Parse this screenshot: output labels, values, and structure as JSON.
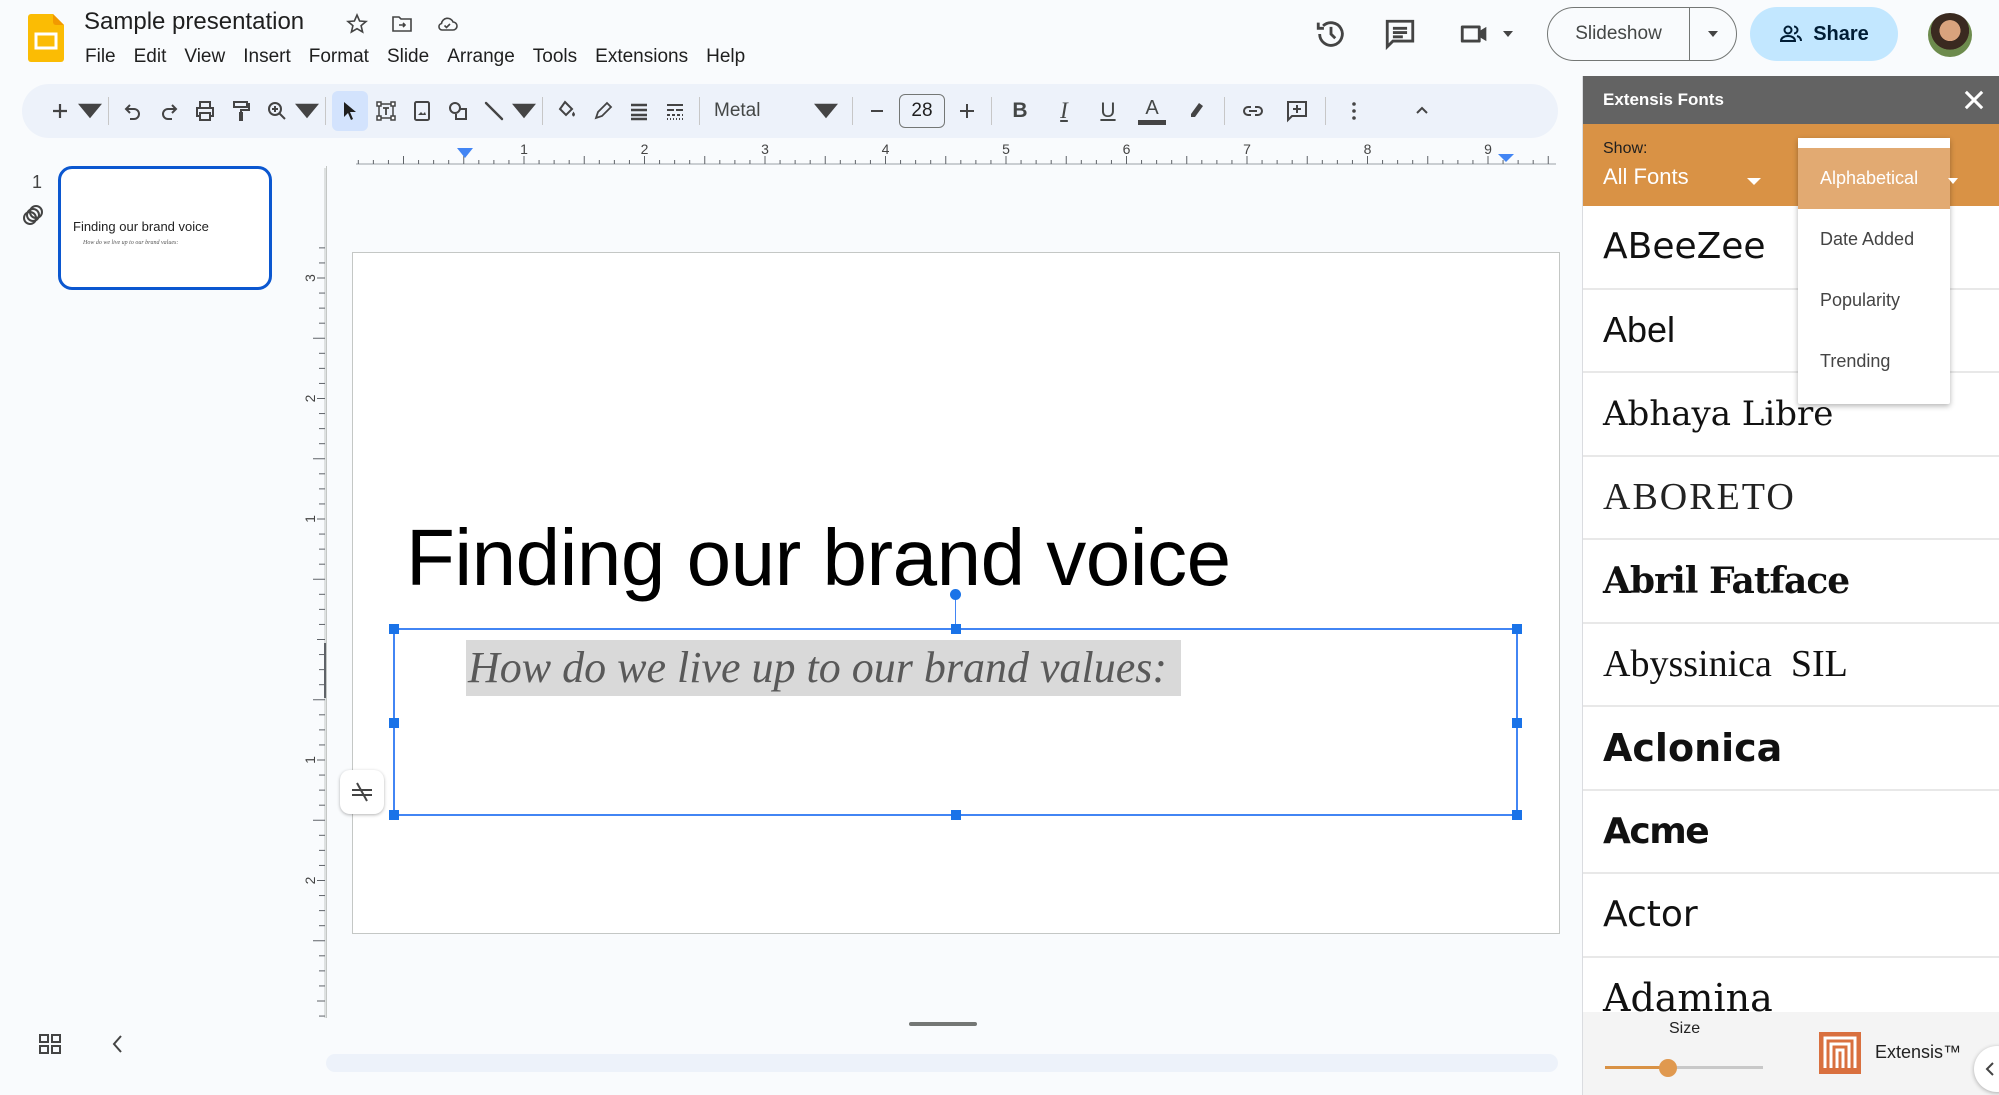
{
  "header": {
    "title": "Sample presentation",
    "menu": [
      "File",
      "Edit",
      "View",
      "Insert",
      "Format",
      "Slide",
      "Arrange",
      "Tools",
      "Extensions",
      "Help"
    ],
    "slideshow_label": "Slideshow",
    "share_label": "Share",
    "icons": [
      "star-icon",
      "move-to-folder-icon",
      "cloud-saved-icon",
      "version-history-icon",
      "comments-icon",
      "meet-icon"
    ]
  },
  "toolbar": {
    "font": "Metal",
    "font_size": "28",
    "bold": "B",
    "italic": "I",
    "underline": "U",
    "text_color": "A"
  },
  "slides_panel": {
    "slide_number": "1",
    "thumb_title": "Finding our brand voice",
    "thumb_subtitle": "How do we live up to our brand values:"
  },
  "ruler": {
    "horizontal_ticks": [
      "1",
      "2",
      "3",
      "4",
      "5",
      "6",
      "7",
      "8",
      "9"
    ],
    "vertical_ticks": [
      "3",
      "2",
      "1",
      "1",
      "2"
    ]
  },
  "slide": {
    "title": "Finding our brand voice",
    "subtitle": "How do we live up to our brand values:"
  },
  "extensis": {
    "panel_title": "Extensis Fonts",
    "show_label": "Show:",
    "show_value": "All Fonts",
    "sort_options": [
      "Alphabetical",
      "Date Added",
      "Popularity",
      "Trending"
    ],
    "sort_selected": "Alphabetical",
    "fonts": [
      "ABeeZee",
      "Abel",
      "Abhaya Libre",
      "ABORETO",
      "Abril Fatface",
      "Abyssinica  SIL",
      "Aclonica",
      "Acme",
      "Actor",
      "Adamina"
    ],
    "size_label": "Size",
    "size_value_fraction": 0.4,
    "brand": "Extensis™",
    "accent_color": "#d99245",
    "header_color": "#636363"
  }
}
